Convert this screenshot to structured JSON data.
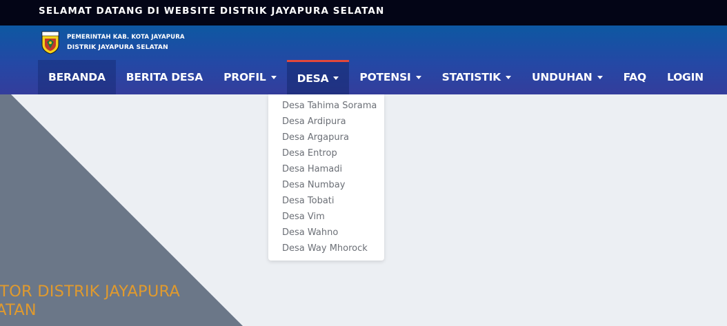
{
  "topbar": {
    "welcome_text": "SELAMAT DATANG DI WEBSITE DISTRIK JAYAPURA SELATAN"
  },
  "brand": {
    "logo_icon": "kota-jayapura-emblem-icon",
    "line1": "PEMERINTAH KAB. KOTA JAYAPURA",
    "line2": "DISTRIK JAYAPURA SELATAN"
  },
  "nav": {
    "items": [
      {
        "label": "BERANDA",
        "dropdown": false
      },
      {
        "label": "BERITA DESA",
        "dropdown": false
      },
      {
        "label": "PROFIL",
        "dropdown": true
      },
      {
        "label": "DESA",
        "dropdown": true,
        "active": true
      },
      {
        "label": "POTENSI",
        "dropdown": true
      },
      {
        "label": "STATISTIK",
        "dropdown": true
      },
      {
        "label": "UNDUHAN",
        "dropdown": true
      },
      {
        "label": "FAQ",
        "dropdown": false
      },
      {
        "label": "LOGIN",
        "dropdown": false
      }
    ]
  },
  "desa_menu": {
    "items": [
      "Desa Tahima Sorama",
      "Desa Ardipura",
      "Desa Argapura",
      "Desa Entrop",
      "Desa Hamadi",
      "Desa Numbay",
      "Desa Tobati",
      "Desa Vim",
      "Desa Wahno",
      "Desa Way Mhorock"
    ]
  },
  "hero": {
    "title_line1": "KANTOR DISTRIK JAYAPURA",
    "title_line2": "SELATAN"
  },
  "colors": {
    "topbar_bg": "#030516",
    "header_top": "#0d58a2",
    "header_bottom": "#343d9c",
    "active_indicator": "#e2483a",
    "hero_shape": "#6b7788",
    "hero_title": "#e09a2e",
    "page_bg": "#eceff3"
  }
}
